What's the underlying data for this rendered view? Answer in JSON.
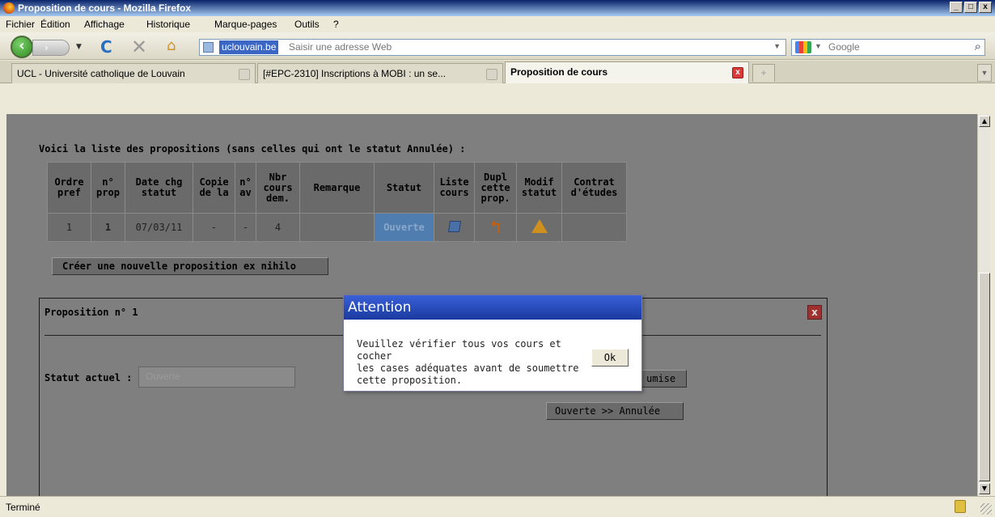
{
  "window": {
    "title": "Proposition de cours - Mozilla Firefox",
    "controls": [
      "_",
      "□",
      "x"
    ]
  },
  "menu": [
    "Fichier",
    "Édition",
    "Affichage",
    "Historique",
    "Marque-pages",
    "Outils",
    "?"
  ],
  "nav": {
    "url_domain": "uclouvain.be",
    "url_placeholder": "Saisir une adresse Web",
    "search_placeholder": "Google"
  },
  "tabs": [
    {
      "label": "UCL - Université catholique de Louvain",
      "icon": "ucl"
    },
    {
      "label": "[#EPC-2310] Inscriptions à MOBI : un se...",
      "icon": "bug"
    },
    {
      "label": "Proposition de cours",
      "icon": "page"
    }
  ],
  "page": {
    "intro": "Voici la liste des propositions (sans celles qui ont le statut Annulée) :",
    "table": {
      "headers": [
        "Ordre\npref",
        "n°\nprop",
        "Date chg\nstatut",
        "Copie\nde la",
        "n°\nav",
        "Nbr\ncours\ndem.",
        "Remarque",
        "Statut",
        "Liste\ncours",
        "Dupl\ncette\nprop.",
        "Modif\nstatut",
        "Contrat\nd'études"
      ],
      "rows": [
        {
          "ordre": "1",
          "nprop": "1",
          "date": "07/03/11",
          "copie": "-",
          "nav": "-",
          "nbr": "4",
          "remarque": "",
          "statut": "Ouverte",
          "contrat": ""
        }
      ]
    },
    "create_button": "Créer une nouvelle proposition ex nihilo",
    "panel": {
      "title": "Proposition n° 1",
      "status_label": "Statut actuel :",
      "status_value": "Ouverte",
      "btn_submit_partial": "umise",
      "btn_cancel": "Ouverte >> Annulée"
    }
  },
  "modal": {
    "title": "Attention",
    "text": "Veuillez vérifier tous vos cours et cocher\nles cases adéquates avant de soumettre\ncette proposition.",
    "ok": "Ok"
  },
  "status": {
    "text": "Terminé"
  }
}
